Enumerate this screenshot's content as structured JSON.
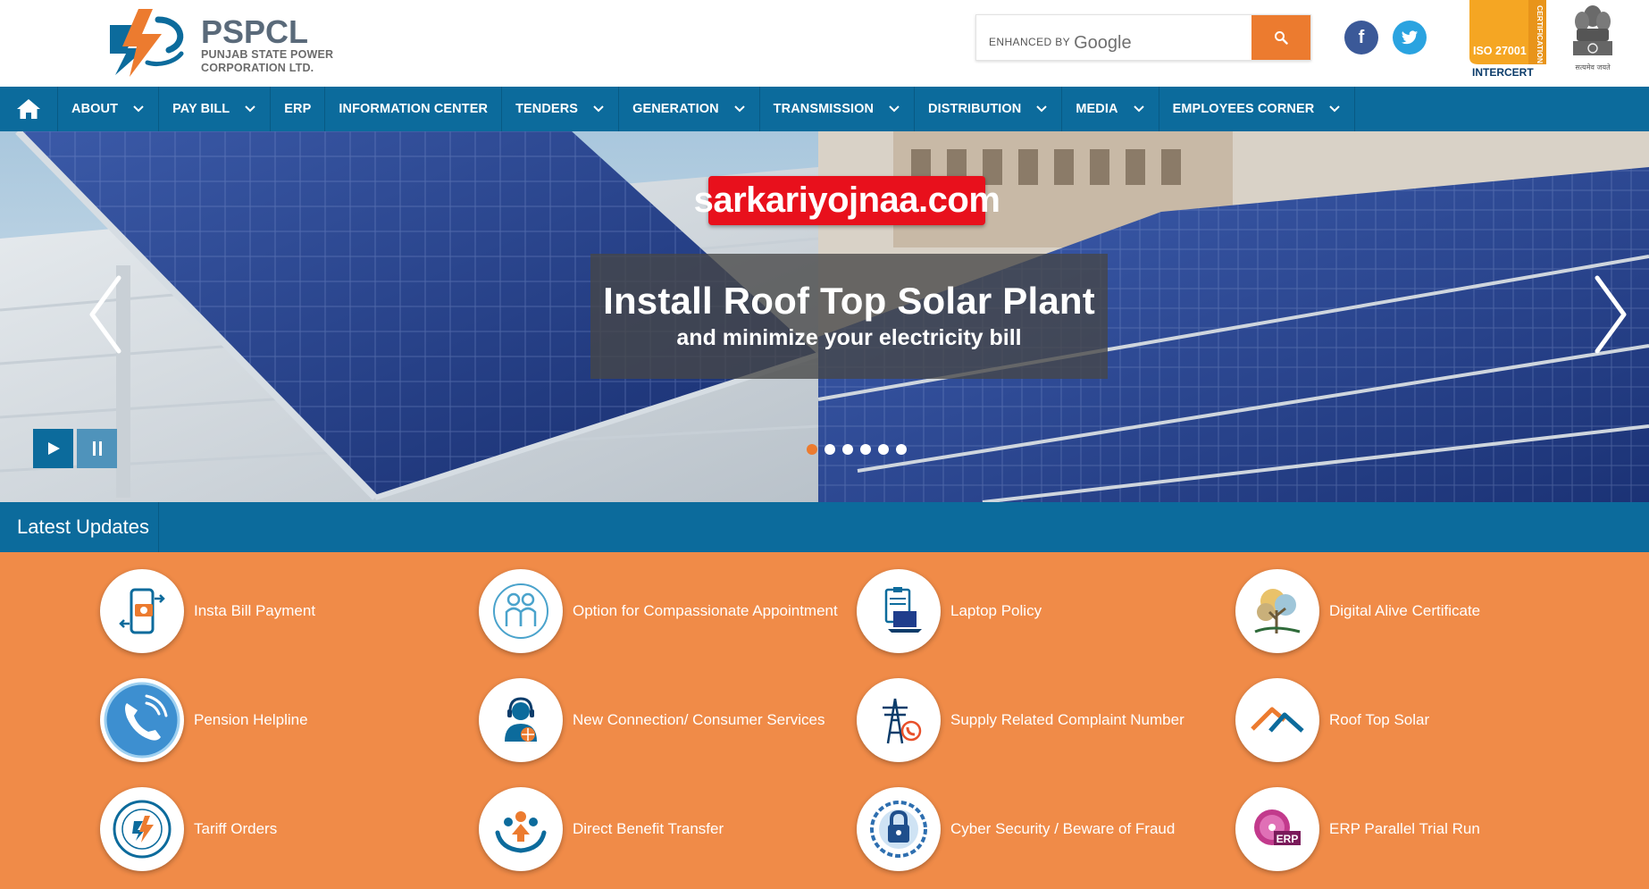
{
  "logo": {
    "title": "PSPCL",
    "subtitle_1": "PUNJAB STATE POWER",
    "subtitle_2": "CORPORATION LTD."
  },
  "search": {
    "placeholder": "",
    "brand_prefix": "ENHANCED BY",
    "brand_name": "Google",
    "button_icon": "search-icon"
  },
  "social": {
    "facebook": "f",
    "twitter_icon": "twitter-bird-icon"
  },
  "iso": {
    "line1": "ISO 27001",
    "vertical": "CERTIFICATION",
    "brand": "INTERCERT"
  },
  "emblem": {
    "caption": "सत्यमेव जयते"
  },
  "nav": {
    "home_icon": "home-icon",
    "items": [
      {
        "label": "ABOUT",
        "dropdown": true
      },
      {
        "label": "PAY BILL",
        "dropdown": true
      },
      {
        "label": "ERP",
        "dropdown": false
      },
      {
        "label": "INFORMATION CENTER",
        "dropdown": false
      },
      {
        "label": "TENDERS",
        "dropdown": true
      },
      {
        "label": "GENERATION",
        "dropdown": true
      },
      {
        "label": "TRANSMISSION",
        "dropdown": true
      },
      {
        "label": "DISTRIBUTION",
        "dropdown": true
      },
      {
        "label": "MEDIA",
        "dropdown": true
      },
      {
        "label": "EMPLOYEES CORNER",
        "dropdown": true
      }
    ]
  },
  "banner": {
    "watermark": "sarkariyojnaa.com",
    "title": "Install Roof Top Solar Plant",
    "subtitle": "and minimize your electricity bill",
    "slide_count": 6,
    "active_slide": 1
  },
  "updates": {
    "label": "Latest Updates"
  },
  "links": {
    "items": [
      {
        "label": "Insta Bill Payment",
        "icon": "mobile-bill-payment-icon"
      },
      {
        "label": "Option for Compassionate Appointment",
        "icon": "people-icon"
      },
      {
        "label": "Laptop Policy",
        "icon": "laptop-clipboard-icon"
      },
      {
        "label": "Digital Alive Certificate",
        "icon": "tree-icon"
      },
      {
        "label": "Pension Helpline",
        "icon": "phone-icon"
      },
      {
        "label": "New Connection/ Consumer Services",
        "icon": "customer-support-icon"
      },
      {
        "label": "Supply Related Complaint Number",
        "icon": "power-tower-icon"
      },
      {
        "label": "Roof Top Solar",
        "icon": "roof-icon"
      },
      {
        "label": "Tariff Orders",
        "icon": "pspcl-seal-icon"
      },
      {
        "label": "Direct Benefit Transfer",
        "icon": "family-hands-icon"
      },
      {
        "label": "Cyber Security / Beware of Fraud",
        "icon": "padlock-icon"
      },
      {
        "label": "ERP Parallel Trial Run",
        "icon": "erp-disc-icon"
      }
    ]
  },
  "colors": {
    "primary_blue": "#0c6b9c",
    "accent_orange": "#ec7b2f",
    "links_bg": "#f08b48"
  }
}
